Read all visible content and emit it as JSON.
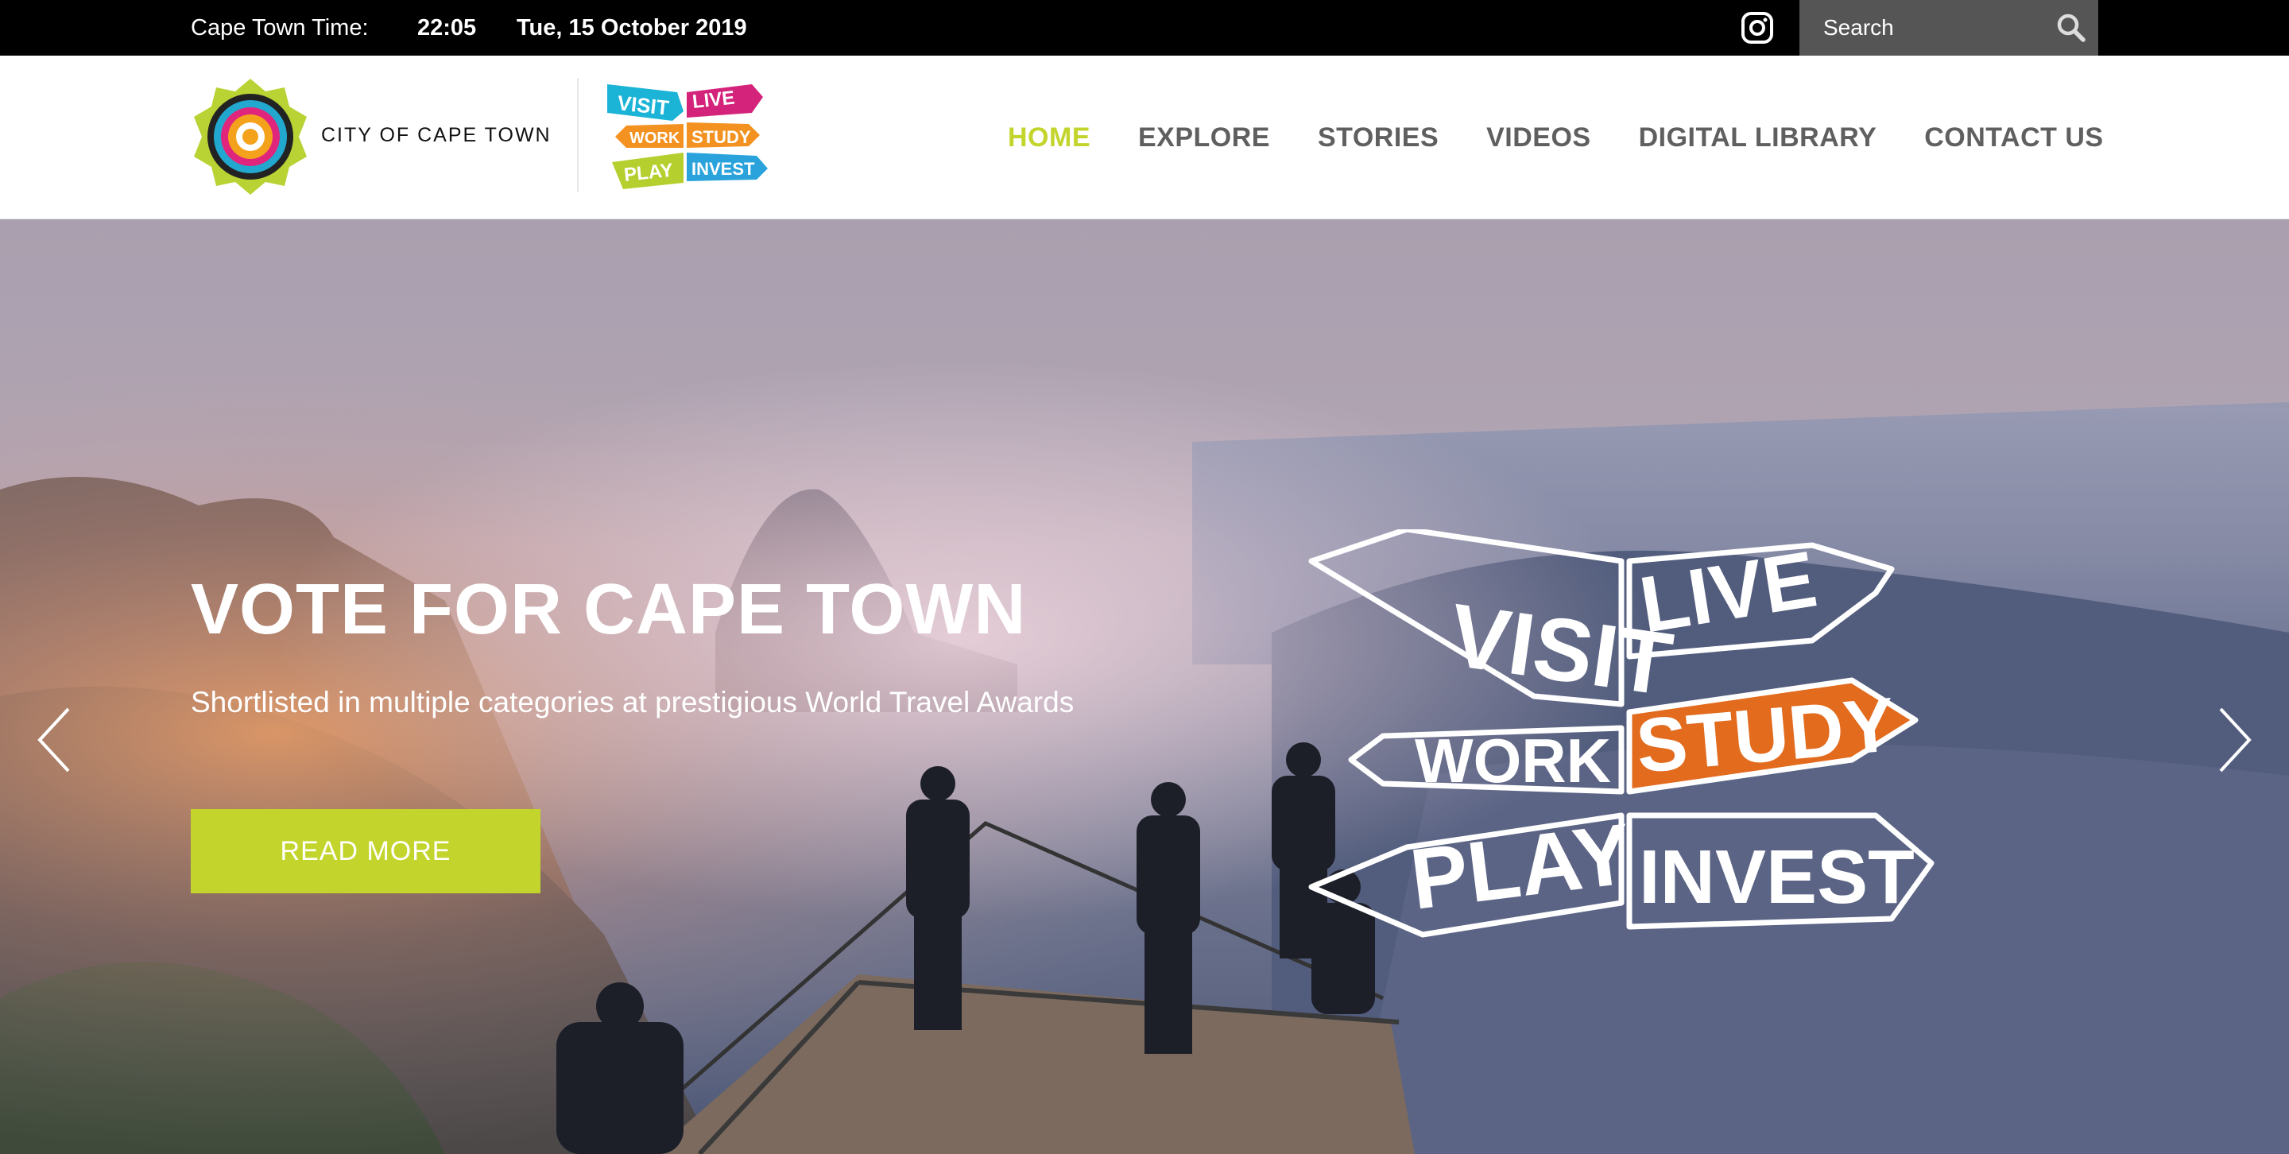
{
  "topbar": {
    "time_label": "Cape Town Time:",
    "time_value": "22:05",
    "date_value": "Tue, 15 October 2019",
    "instagram_icon": "instagram-icon",
    "search_placeholder": "Search",
    "search_icon": "magnifier-icon"
  },
  "header": {
    "city_name": "CITY OF CAPE TOWN",
    "brand_logo_words": [
      "VISIT",
      "LIVE",
      "WORK",
      "STUDY",
      "PLAY",
      "INVEST"
    ]
  },
  "nav": {
    "items": [
      {
        "label": "HOME",
        "active": true
      },
      {
        "label": "EXPLORE",
        "active": false
      },
      {
        "label": "STORIES",
        "active": false
      },
      {
        "label": "VIDEOS",
        "active": false
      },
      {
        "label": "DIGITAL LIBRARY",
        "active": false
      },
      {
        "label": "CONTACT US",
        "active": false
      }
    ]
  },
  "hero": {
    "title": "VOTE FOR CAPE TOWN",
    "subtitle": "Shortlisted in multiple categories at prestigious World Travel Awards",
    "cta_label": "READ MORE",
    "prev_icon": "chevron-left-icon",
    "next_icon": "chevron-right-icon",
    "signpost_words": [
      "VISIT",
      "LIVE",
      "WORK",
      "STUDY",
      "PLAY",
      "INVEST"
    ]
  },
  "colors": {
    "accent": "#c3d52d",
    "topbar_bg": "#000000",
    "nav_text": "#5f5f5f",
    "study_orange": "#e26b1e",
    "visit_cyan": "#1bb3d6",
    "live_magenta": "#d4237a",
    "work_orange": "#f39220",
    "play_green": "#b5cf2e",
    "invest_blue": "#2aa3dc"
  }
}
